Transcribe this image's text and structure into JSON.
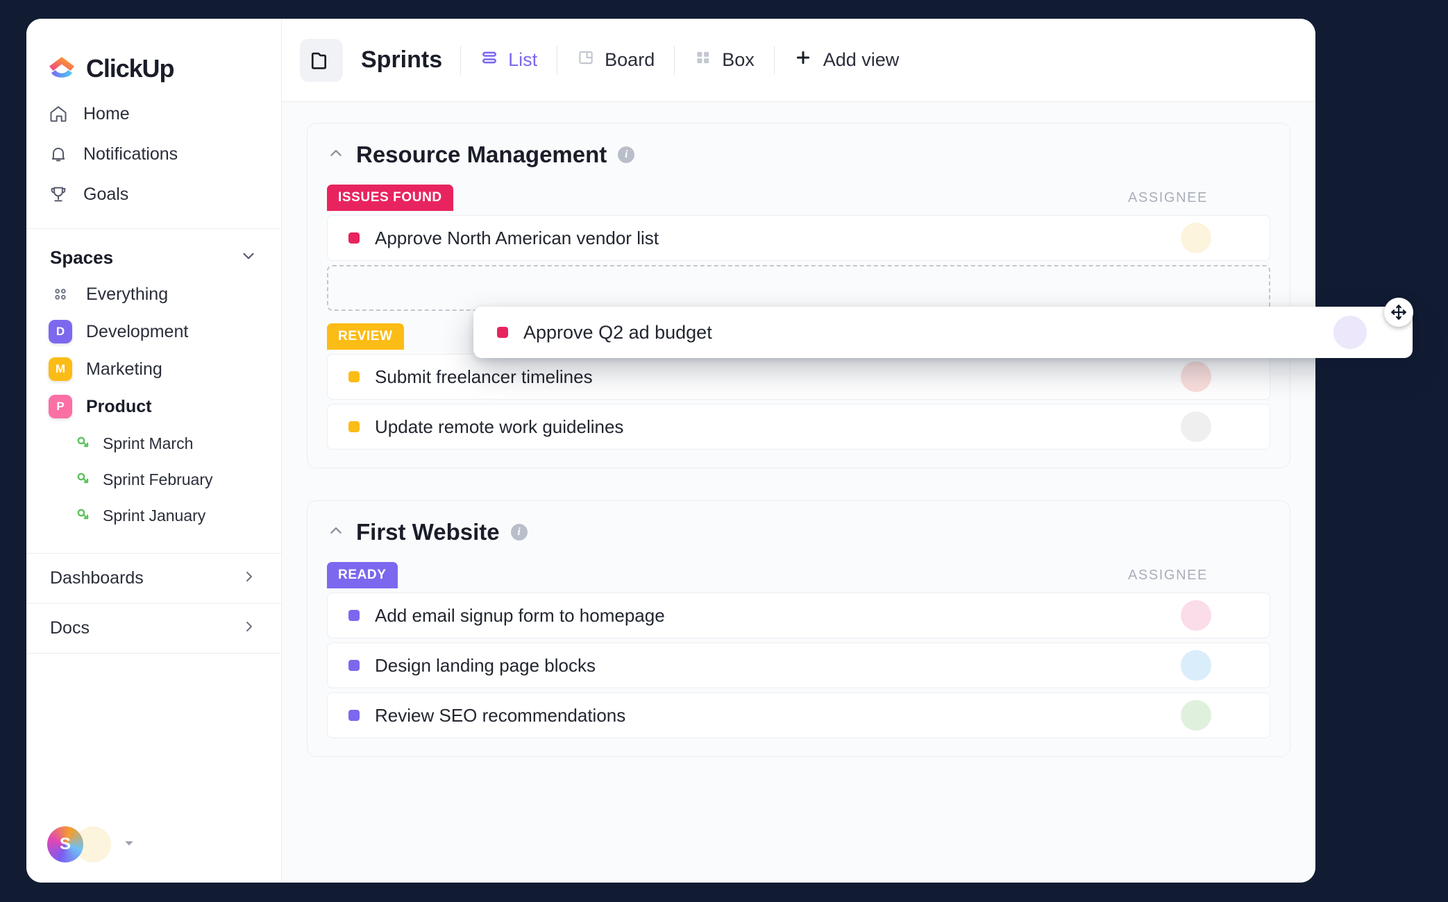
{
  "app": {
    "brand": "ClickUp",
    "logo_icon": "clickup-logo-icon"
  },
  "sidebar": {
    "nav": [
      {
        "label": "Home",
        "icon": "home-icon"
      },
      {
        "label": "Notifications",
        "icon": "bell-icon"
      },
      {
        "label": "Goals",
        "icon": "trophy-icon"
      }
    ],
    "spaces": {
      "title": "Spaces",
      "chevron": "chevron-down-icon",
      "everything": {
        "label": "Everything",
        "icon": "grid-dots-icon"
      },
      "items": [
        {
          "label": "Development",
          "initial": "D",
          "color": "#7b68ee",
          "active": false
        },
        {
          "label": "Marketing",
          "initial": "M",
          "color": "#fcbc16",
          "active": false
        },
        {
          "label": "Product",
          "initial": "P",
          "color": "#fb6fa5",
          "active": true
        }
      ],
      "sprints": [
        {
          "label": "Sprint  March",
          "icon": "sprint-icon"
        },
        {
          "label": "Sprint  February",
          "icon": "sprint-icon"
        },
        {
          "label": "Sprint January",
          "icon": "sprint-icon"
        }
      ]
    },
    "sections": [
      {
        "label": "Dashboards",
        "chevron": "chevron-right-icon"
      },
      {
        "label": "Docs",
        "chevron": "chevron-right-icon"
      }
    ],
    "footer": {
      "workspace_initial": "S",
      "avatar": "user-avatar",
      "caret": "caret-down-icon"
    }
  },
  "topbar": {
    "folder_icon": "folder-icon",
    "title": "Sprints",
    "views": [
      {
        "label": "List",
        "icon": "list-view-icon",
        "active": true
      },
      {
        "label": "Board",
        "icon": "board-view-icon",
        "active": false
      },
      {
        "label": "Box",
        "icon": "box-view-icon",
        "active": false
      }
    ],
    "add_view": {
      "label": "Add view",
      "icon": "plus-icon"
    }
  },
  "groups": [
    {
      "title": "Resource Management",
      "collapse_icon": "chevron-up-icon",
      "info_icon": "info-icon",
      "assignee_header": "ASSIGNEE",
      "statuses": [
        {
          "label": "ISSUES FOUND",
          "color": "#e8245f",
          "tasks": [
            {
              "name": "Approve North American vendor list",
              "dot_color": "#e8245f",
              "avatar_bg": "#fdf4dd"
            }
          ],
          "has_drop_zone": true
        },
        {
          "label": "REVIEW",
          "color": "#fcbc16",
          "tasks": [
            {
              "name": "Submit freelancer timelines",
              "dot_color": "#fcbc16",
              "avatar_bg": "#fbdfdc"
            },
            {
              "name": "Update remote work guidelines",
              "dot_color": "#fcbc16",
              "avatar_bg": "#efefef"
            }
          ],
          "has_drop_zone": false
        }
      ]
    },
    {
      "title": "First Website",
      "collapse_icon": "chevron-up-icon",
      "info_icon": "info-icon",
      "assignee_header": "ASSIGNEE",
      "statuses": [
        {
          "label": "READY",
          "color": "#7b68ee",
          "tasks": [
            {
              "name": "Add email signup form to homepage",
              "dot_color": "#7b68ee",
              "avatar_bg": "#fbdde9"
            },
            {
              "name": "Design landing page blocks",
              "dot_color": "#7b68ee",
              "avatar_bg": "#d9edfb"
            },
            {
              "name": "Review SEO recommendations",
              "dot_color": "#7b68ee",
              "avatar_bg": "#dff0dd"
            }
          ],
          "has_drop_zone": false
        }
      ]
    }
  ],
  "drag": {
    "task_name": "Approve Q2 ad budget",
    "dot_color": "#e8245f",
    "avatar_bg": "#ece7fa",
    "cursor_icon": "move-cursor-icon"
  },
  "colors": {
    "accent": "#7b68ee",
    "page_bg": "#111c33",
    "content_bg": "#fafbfc",
    "issues_found": "#e8245f",
    "review": "#fcbc16",
    "ready": "#7b68ee"
  }
}
